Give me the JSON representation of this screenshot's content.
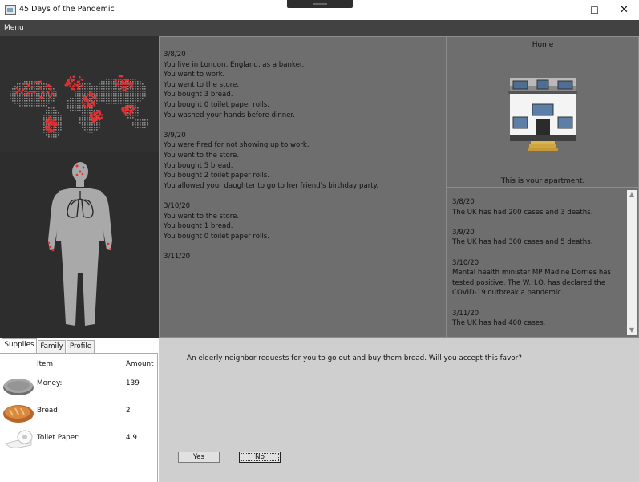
{
  "window": {
    "title": "45 Days of the Pandemic",
    "minimize": "—",
    "maximize": "☐",
    "close": "✕"
  },
  "menu": {
    "label": "Menu"
  },
  "log": {
    "text": "3/8/20\nYou live in London, England, as a banker.\nYou went to work.\nYou went to the store.\nYou bought 3 bread.\nYou bought 0 toilet paper rolls.\nYou washed your hands before dinner.\n\n3/9/20\nYou were fired for not showing up to work.\nYou went to the store.\nYou bought 5 bread.\nYou bought 2 toilet paper rolls.\nYou allowed your daughter to go to her friend's birthday party.\n\n3/10/20\nYou went to the store.\nYou bought 1 bread.\nYou bought 0 toilet paper rolls.\n\n3/11/20"
  },
  "home": {
    "title": "Home",
    "caption": "This is your apartment."
  },
  "news": {
    "text": "3/8/20\nThe UK has had 200 cases and 3 deaths.\n\n3/9/20\nThe UK has had 300 cases and 5 deaths.\n\n3/10/20\nMental health minister MP Madine Dorries has\ntested positive. The W.H.O. has declared the\nCOVID-19 outbreak a pandemic.\n\n3/11/20\nThe UK has had 400 cases."
  },
  "inventory": {
    "tabs": [
      "Supplies",
      "Family",
      "Profile"
    ],
    "active_tab": "Supplies",
    "headers": {
      "item": "Item",
      "amount": "Amount"
    },
    "rows": [
      {
        "icon": "coin-icon",
        "label": "Money:",
        "value": "139"
      },
      {
        "icon": "bread-icon",
        "label": "Bread:",
        "value": "2"
      },
      {
        "icon": "toilet-paper-icon",
        "label": "Toilet Paper:",
        "value": "4.9"
      }
    ]
  },
  "event": {
    "prompt": "An elderly neighbor requests for you to go out and buy them bread. Will you accept this favor?",
    "yes_label": "Yes",
    "no_label": "No"
  },
  "colors": {
    "infection": "#e53030",
    "panel": "#6e6e6e",
    "dark": "#2d2d2d"
  }
}
